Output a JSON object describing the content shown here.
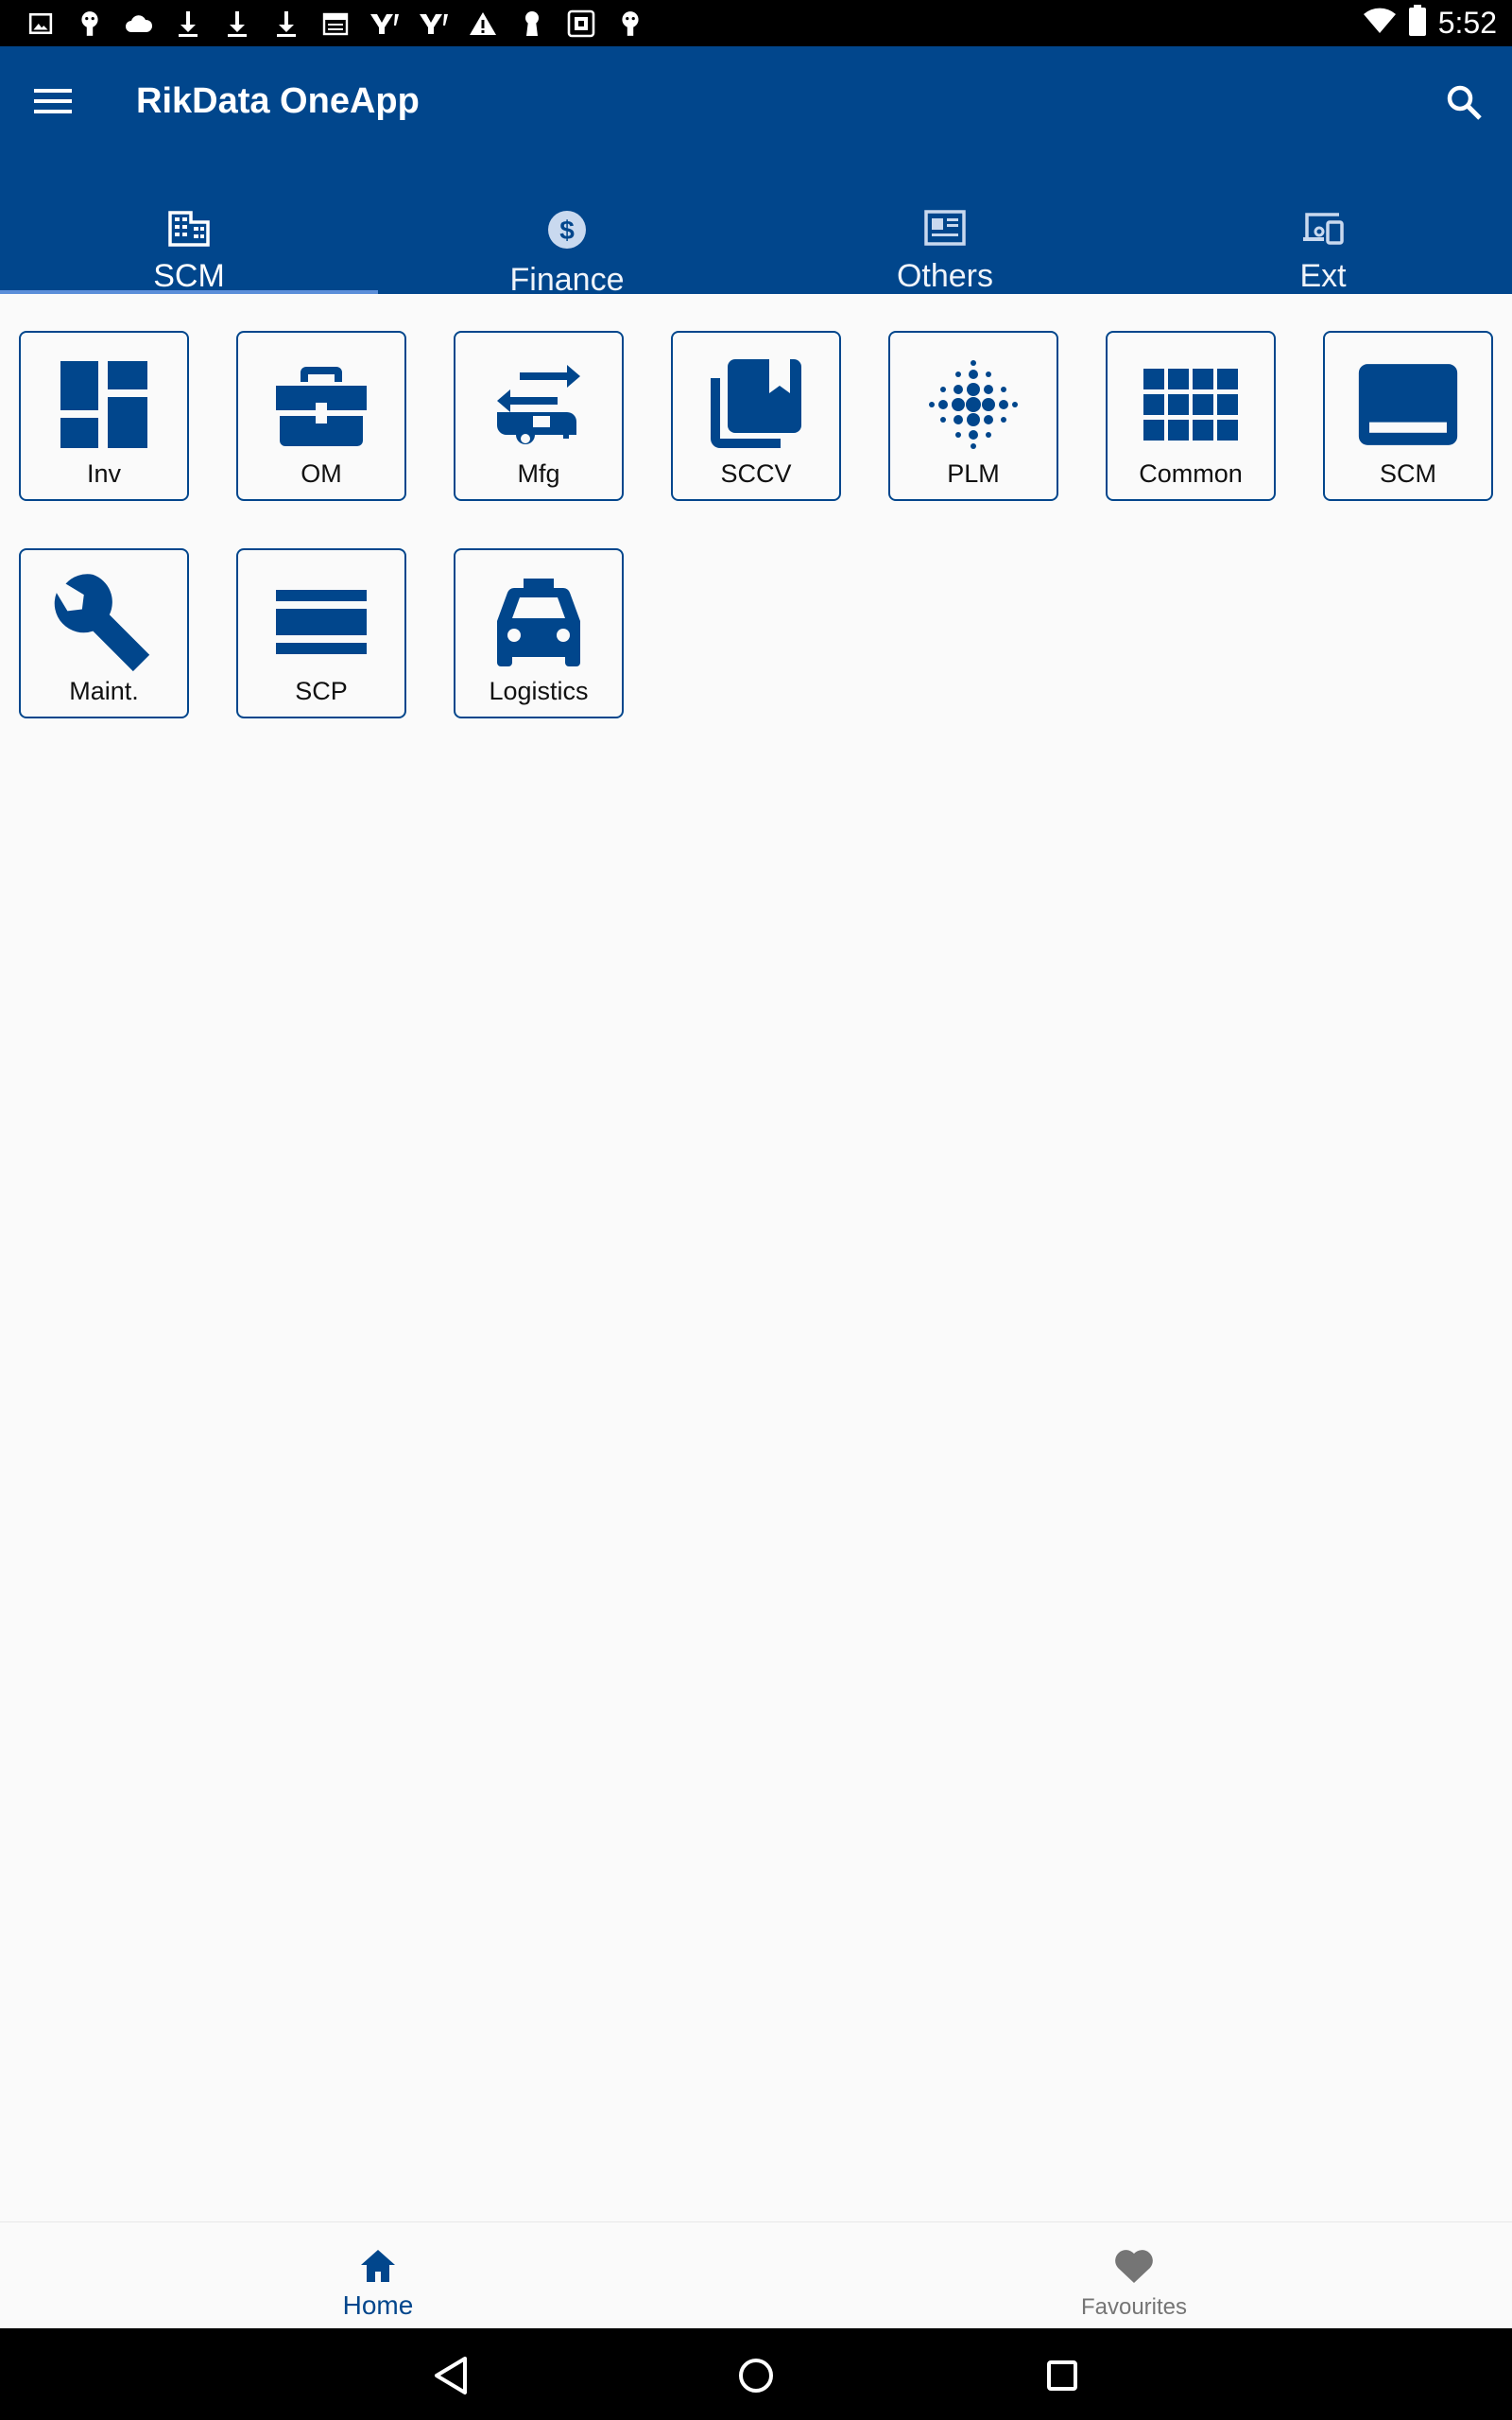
{
  "status_bar": {
    "time": "5:52",
    "notification_icons": [
      "image-icon",
      "android-icon",
      "cloud-icon",
      "download-icon",
      "download-icon",
      "download-icon",
      "calendar-icon",
      "yahoo-icon",
      "yahoo-icon",
      "warning-icon",
      "keyhole-icon",
      "gallery-icon",
      "android-icon"
    ],
    "wifi_icon": "wifi-icon",
    "battery_icon": "battery-icon"
  },
  "app_bar": {
    "title": "RikData OneApp",
    "menu_icon": "menu-icon",
    "search_icon": "search-icon",
    "color": "#01468c"
  },
  "tabs": [
    {
      "label": "SCM",
      "icon": "building-icon",
      "active": true
    },
    {
      "label": "Finance",
      "icon": "dollar-circle-icon",
      "active": false
    },
    {
      "label": "Others",
      "icon": "newspaper-icon",
      "active": false
    },
    {
      "label": "Ext",
      "icon": "devices-icon",
      "active": false
    }
  ],
  "tiles": [
    {
      "label": "Inv",
      "icon": "dashboard-icon"
    },
    {
      "label": "OM",
      "icon": "briefcase-icon"
    },
    {
      "label": "Mfg",
      "icon": "rv-transfer-icon"
    },
    {
      "label": "SCCV",
      "icon": "collections-bookmark-icon"
    },
    {
      "label": "PLM",
      "icon": "dot-grid-icon"
    },
    {
      "label": "Common",
      "icon": "keypad-grid-icon"
    },
    {
      "label": "SCM",
      "icon": "laptop-icon"
    },
    {
      "label": "Maint.",
      "icon": "wrench-icon"
    },
    {
      "label": "SCP",
      "icon": "lines-icon"
    },
    {
      "label": "Logistics",
      "icon": "taxi-icon"
    }
  ],
  "bottom_nav": [
    {
      "label": "Home",
      "icon": "home-icon",
      "active": true
    },
    {
      "label": "Favourites",
      "icon": "heart-icon",
      "active": false
    }
  ],
  "system_nav": {
    "back_icon": "back-triangle-icon",
    "home_icon": "home-circle-icon",
    "recents_icon": "recents-square-icon"
  }
}
